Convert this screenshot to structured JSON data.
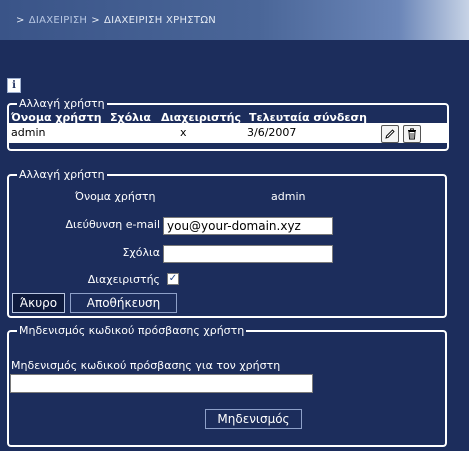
{
  "breadcrumb": {
    "item1": "ΔΙΑΧΕΙΡΙΣΗ",
    "item2": "ΔΙΑΧΕΙΡΙΣΗ ΧΡΗΣΤΩΝ",
    "separator": ">"
  },
  "info_icon": "i",
  "user_list": {
    "legend": "Αλλαγή χρήστη",
    "columns": [
      "Όνομα χρήστη",
      "Σχόλια",
      "Διαχειριστής",
      "Τελευταία σύνδεση"
    ],
    "rows": [
      {
        "username": "admin",
        "comments": "",
        "admin": "x",
        "last_login": "3/6/2007"
      }
    ]
  },
  "edit_user": {
    "legend": "Αλλαγή χρήστη",
    "username_label": "Όνομα χρήστη",
    "username_value": "admin",
    "email_label": "Διεύθυνση e-mail",
    "email_value": "you@your-domain.xyz",
    "comments_label": "Σχόλια",
    "comments_value": "",
    "admin_label": "Διαχειριστής",
    "admin_checked": true,
    "cancel_label": "Άκυρο",
    "save_label": "Αποθήκευση"
  },
  "reset_password": {
    "legend": "Μηδενισμός κωδικού πρόσβασης χρήστη",
    "field_label": "Μηδενισμός κωδικού πρόσβασης για τον χρήστη",
    "field_value": "",
    "button_label": "Μηδενισμός"
  },
  "colors": {
    "background": "#1c2d5c",
    "header_gradient_start": "#3a5488",
    "header_gradient_end": "#c7d3e6"
  }
}
